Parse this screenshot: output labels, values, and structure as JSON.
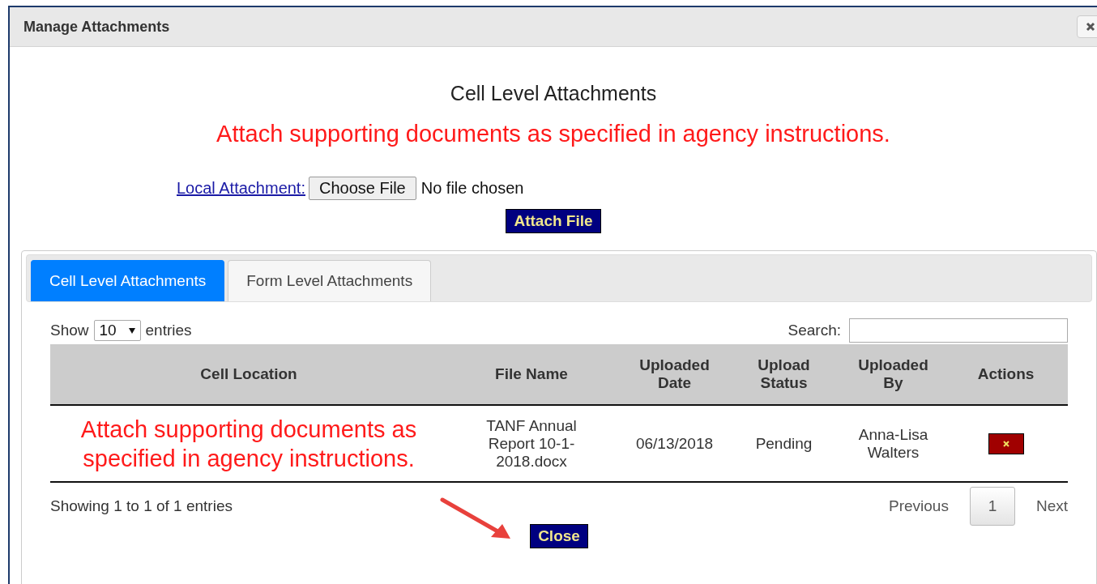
{
  "dialog": {
    "title": "Manage Attachments"
  },
  "heading": "Cell Level Attachments",
  "instruction": "Attach supporting documents as specified in agency instructions.",
  "attachment": {
    "label": "Local Attachment:",
    "choose_button": "Choose File",
    "file_status": "No file chosen",
    "attach_button": "Attach File"
  },
  "tabs": [
    {
      "label": "Cell Level Attachments",
      "selected": true
    },
    {
      "label": "Form Level Attachments",
      "selected": false
    }
  ],
  "table": {
    "show_label": "Show",
    "page_size": "10",
    "entries_label": "entries",
    "search_label": "Search:",
    "columns": [
      "Cell Location",
      "File Name",
      "Uploaded Date",
      "Upload Status",
      "Uploaded By",
      "Actions"
    ],
    "rows": [
      {
        "cells": [
          "Attach supporting documents as specified in agency instructions.",
          "TANF Annual Report 10-1-2018.docx",
          "06/13/2018",
          "Pending",
          "Anna-Lisa Walters"
        ]
      }
    ],
    "info": "Showing 1 to 1 of 1 entries",
    "pagination": {
      "previous": "Previous",
      "pages": [
        {
          "label": "1",
          "selected": true
        }
      ],
      "next": "Next"
    }
  },
  "close_button": "Close"
}
